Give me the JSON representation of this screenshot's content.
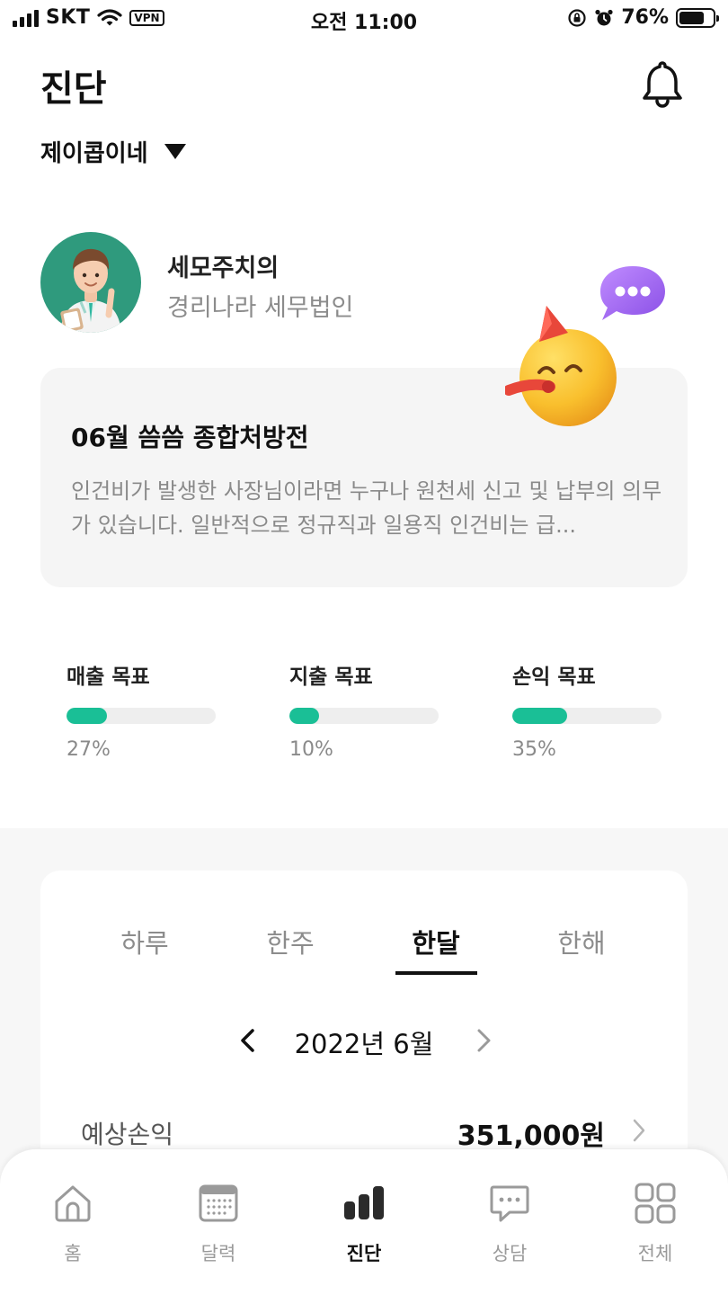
{
  "status_bar": {
    "carrier": "SKT",
    "vpn": "VPN",
    "time": "오전 11:00",
    "battery": "76%",
    "battery_level": 0.76
  },
  "header": {
    "title": "진단",
    "company": "제이콥이네"
  },
  "doctor": {
    "name": "세모주치의",
    "org": "경리나라 세무법인"
  },
  "prescription": {
    "title": "06월 씀씀 종합처방전",
    "body": "인건비가 발생한 사장님이라면 누구나 원천세 신고 및 납부의 의무가 있습니다. 일반적으로 정규직과 일용직 인건비는 급..."
  },
  "goals": [
    {
      "label": "매출 목표",
      "value": "27%",
      "fraction": 0.27
    },
    {
      "label": "지출 목표",
      "value": "10%",
      "fraction": 0.2
    },
    {
      "label": "손익 목표",
      "value": "35%",
      "fraction": 0.37
    }
  ],
  "colors": {
    "accent": "#1abf96",
    "avatar_bg": "#2f9a7d",
    "card_bg": "#f5f5f5",
    "chat_bubble": "#a36cf0",
    "emoji": "#f7b52c"
  },
  "report": {
    "tabs": [
      "하루",
      "한주",
      "한달",
      "한해"
    ],
    "active_tab": "한달",
    "month": "2022년 6월",
    "profit_label": "예상손익",
    "profit_value": "351,000원"
  },
  "tab_bar": {
    "items": [
      {
        "label": "홈",
        "icon": "home-icon"
      },
      {
        "label": "달력",
        "icon": "calendar-icon"
      },
      {
        "label": "진단",
        "icon": "bar-chart-icon"
      },
      {
        "label": "상담",
        "icon": "chat-icon"
      },
      {
        "label": "전체",
        "icon": "grid-icon"
      }
    ],
    "active": "진단"
  }
}
